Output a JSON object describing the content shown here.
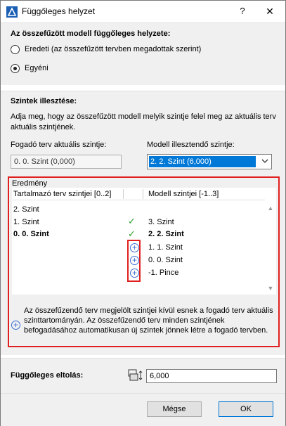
{
  "window": {
    "title": "Függőleges helyzet",
    "help": "?",
    "close": "✕"
  },
  "vertical_position": {
    "heading": "Az összefűzött modell függőleges helyzete:",
    "option_original": "Eredeti (az összefűzött tervben megadottak szerint)",
    "option_custom": "Egyéni",
    "selected": "custom"
  },
  "levels": {
    "heading": "Szintek illesztése:",
    "description": "Adja meg, hogy az összefűzött modell melyik szintje felel meg az aktuális terv aktuális szintjének.",
    "host_label": "Fogadó terv aktuális szintje:",
    "host_value": "0. 0. Szint (0,000)",
    "model_label": "Modell illesztendő szintje:",
    "model_value": "2. 2. Szint (6,000)"
  },
  "result": {
    "heading": "Eredmény",
    "col_host": "Tartalmazó terv szintjei [0..2]",
    "col_model": "Modell szintjei [-1..3]",
    "host_rows": [
      "2. Szint",
      "1. Szint",
      "0. 0. Szint"
    ],
    "model_rows": [
      "3. Szint",
      "2. 2. Szint",
      "1. 1. Szint",
      "0. 0. Szint",
      "-1. Pince"
    ],
    "note": "Az összefűzendő terv megjelölt szintjei kívül esnek a fogadó terv aktuális szinttartományán. Az összefűzendő terv minden szintjének befogadásához automatikusan új szintek jönnek létre a fogadó tervben."
  },
  "offset": {
    "label": "Függőleges eltolás:",
    "value": "6,000"
  },
  "buttons": {
    "cancel": "Mégse",
    "ok": "OK"
  },
  "colors": {
    "accent": "#0078d7",
    "highlight_border": "#e02020",
    "check": "#2ca02c",
    "plus": "#3b6fd6"
  }
}
